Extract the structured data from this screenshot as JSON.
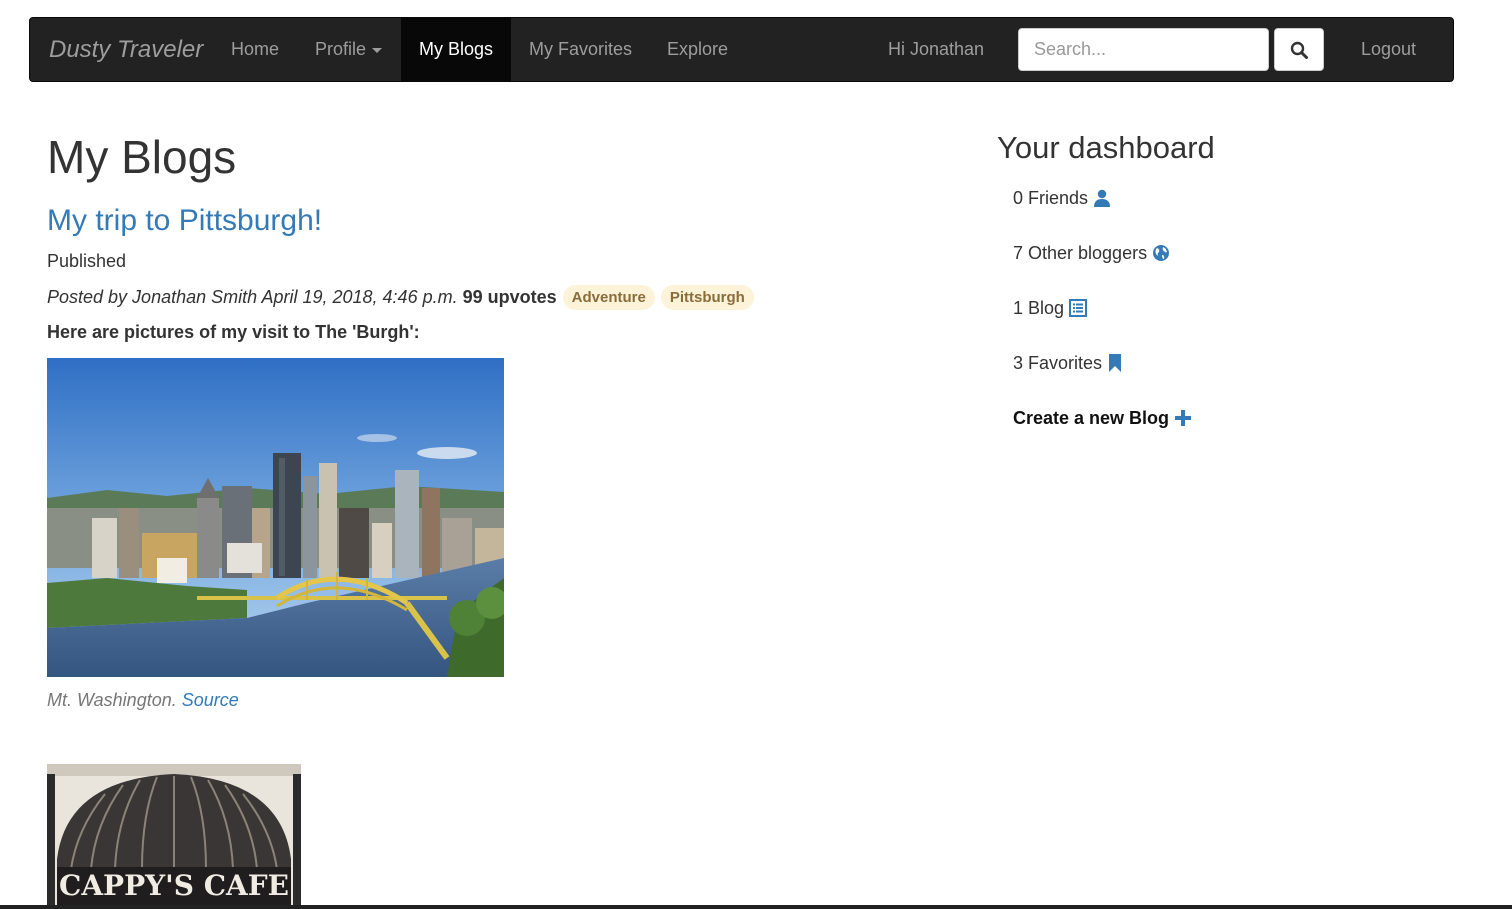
{
  "navbar": {
    "brand": "Dusty Traveler",
    "links": [
      {
        "label": "Home"
      },
      {
        "label": "Profile"
      },
      {
        "label": "My Blogs"
      },
      {
        "label": "My Favorites"
      },
      {
        "label": "Explore"
      }
    ],
    "greeting": "Hi Jonathan",
    "search_placeholder": "Search...",
    "logout_label": "Logout"
  },
  "main": {
    "page_title": "My Blogs",
    "post": {
      "title": "My trip to Pittsburgh!",
      "status": "Published",
      "byline": "Posted by Jonathan Smith April 19, 2018, 4:46 p.m.",
      "upvotes": "99 upvotes",
      "tags": [
        "Adventure",
        "Pittsburgh"
      ],
      "intro": "Here are pictures of my visit to The 'Burgh':",
      "caption_text": "Mt. Washington.",
      "caption_link": "Source",
      "second_image_sign": "CAPPY'S CAFE"
    }
  },
  "sidebar": {
    "title": "Your dashboard",
    "items": [
      {
        "label": "0 Friends",
        "icon": "user-icon"
      },
      {
        "label": "7 Other bloggers",
        "icon": "globe-icon"
      },
      {
        "label": "1 Blog",
        "icon": "list-icon"
      },
      {
        "label": "3 Favorites",
        "icon": "bookmark-icon"
      },
      {
        "label": "Create a new Blog",
        "icon": "plus-icon"
      }
    ]
  },
  "colors": {
    "navbar_bg": "#222222",
    "link_blue": "#337ab7",
    "tag_bg": "#fcf3d9",
    "tag_text": "#8a6d3b"
  }
}
